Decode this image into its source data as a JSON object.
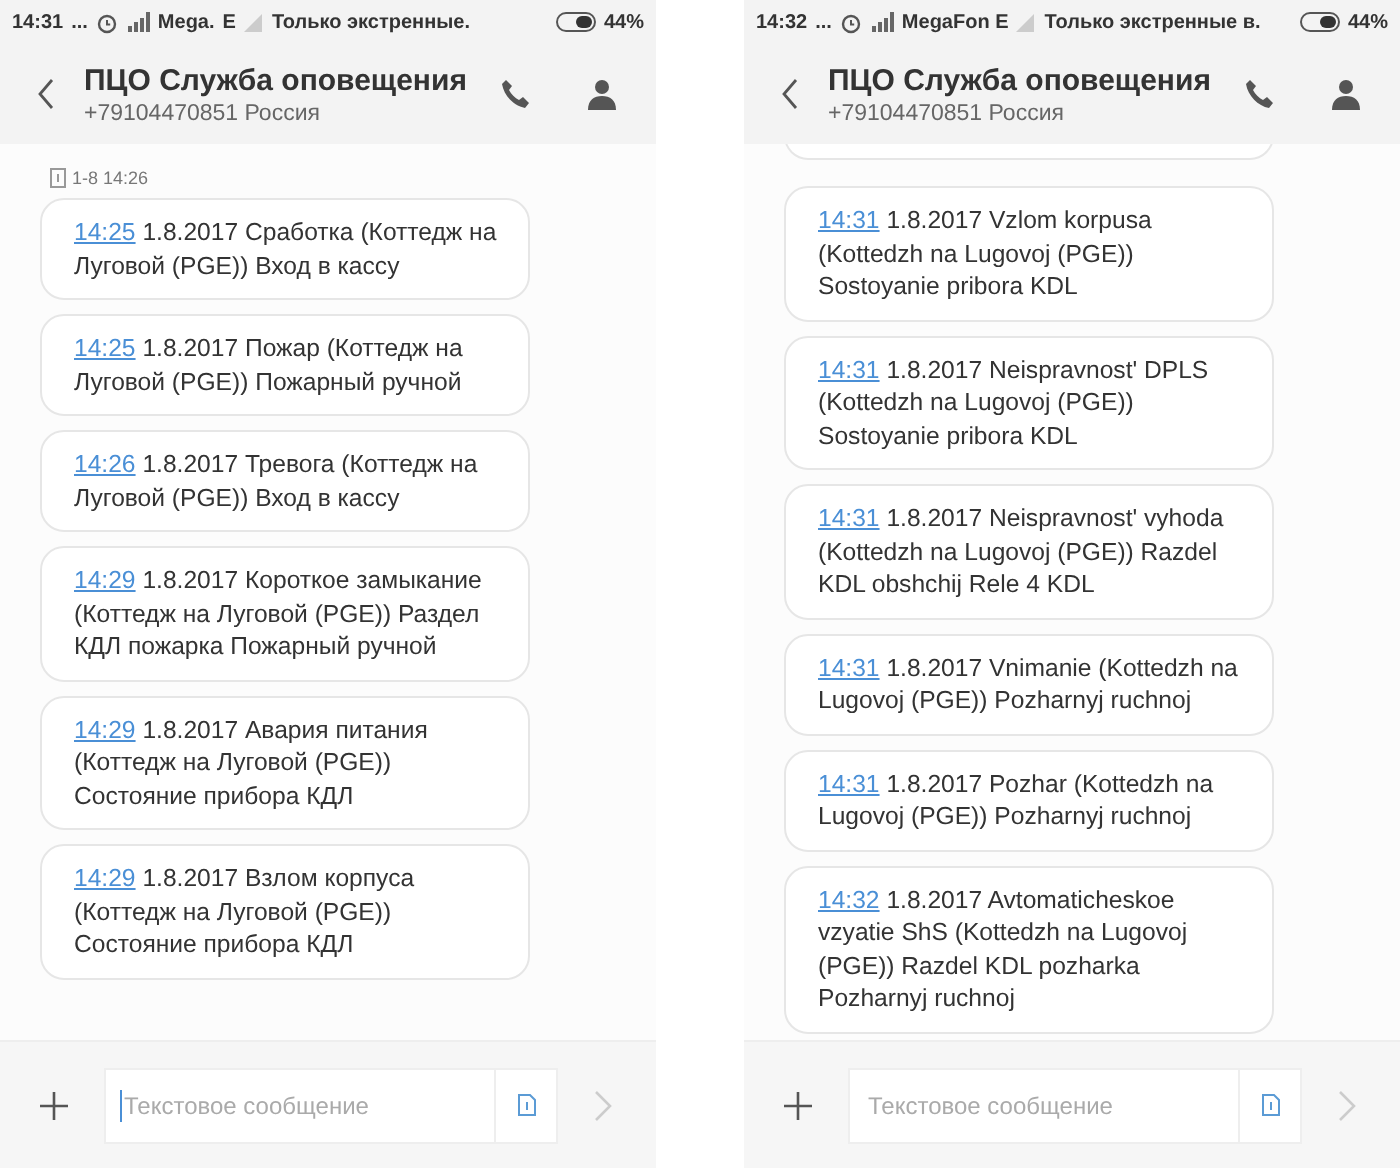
{
  "screens": [
    {
      "status_bar": {
        "time": "14:31",
        "dots": "...",
        "alarm": true,
        "carrier": "Mega.",
        "network": "E",
        "emergency": "Только экстренные.",
        "battery": "44%"
      },
      "header": {
        "title": "ПЦО Служба оповещения",
        "subtitle": "+79104470851 Россия"
      },
      "date_label": "1-8 14:26",
      "cut_bubble_above": false,
      "messages": [
        {
          "time": "14:25",
          "text": "1.8.2017 Сработка (Коттедж на Луговой (PGE)) Вход в кассу"
        },
        {
          "time": "14:25",
          "text": "1.8.2017 Пожар (Коттедж на Луговой (PGE)) Пожарный ручной"
        },
        {
          "time": "14:26",
          "text": "1.8.2017 Тревога (Коттедж на Луговой (PGE)) Вход в кассу"
        },
        {
          "time": "14:29",
          "text": "1.8.2017 Короткое замыкание (Коттедж на Луговой (PGE)) Раздел КДЛ пожарка Пожарный ручной"
        },
        {
          "time": "14:29",
          "text": "1.8.2017 Авария питания (Коттедж на Луговой (PGE)) Состояние прибора КДЛ"
        },
        {
          "time": "14:29",
          "text": "1.8.2017 Взлом корпуса (Коттедж на Луговой (PGE)) Состояние прибора КДЛ"
        }
      ],
      "composer": {
        "placeholder": "Текстовое сообщение",
        "focused": true
      }
    },
    {
      "status_bar": {
        "time": "14:32",
        "dots": "...",
        "alarm": true,
        "carrier": "MegaFon E",
        "emergency": "Только экстренные в.",
        "battery": "44%"
      },
      "header": {
        "title": "ПЦО Служба оповещения",
        "subtitle": "+79104470851 Россия"
      },
      "cut_bubble_above": true,
      "messages": [
        {
          "time": "14:31",
          "text": "1.8.2017 Vzlom korpusa (Kottedzh na Lugovoj (PGE)) Sostoyanie pribora KDL"
        },
        {
          "time": "14:31",
          "text": "1.8.2017 Neispravnost' DPLS (Kottedzh na Lugovoj (PGE))  Sostoyanie pribora KDL"
        },
        {
          "time": "14:31",
          "text": "1.8.2017 Neispravnost' vyhoda (Kottedzh na Lugovoj (PGE)) Razdel KDL obshchij Rele 4 KDL"
        },
        {
          "time": "14:31",
          "text": "1.8.2017 Vnimanie (Kottedzh na Lugovoj (PGE)) Pozharnyj ruchnoj"
        },
        {
          "time": "14:31",
          "text": "1.8.2017 Pozhar (Kottedzh na Lugovoj (PGE)) Pozharnyj ruchnoj"
        },
        {
          "time": "14:32",
          "text": "1.8.2017 Avtomaticheskoe vzyatie ShS (Kottedzh na Lugovoj (PGE)) Razdel KDL pozharka Pozharnyj ruchnoj"
        }
      ],
      "composer": {
        "placeholder": "Текстовое сообщение",
        "focused": false
      }
    }
  ]
}
